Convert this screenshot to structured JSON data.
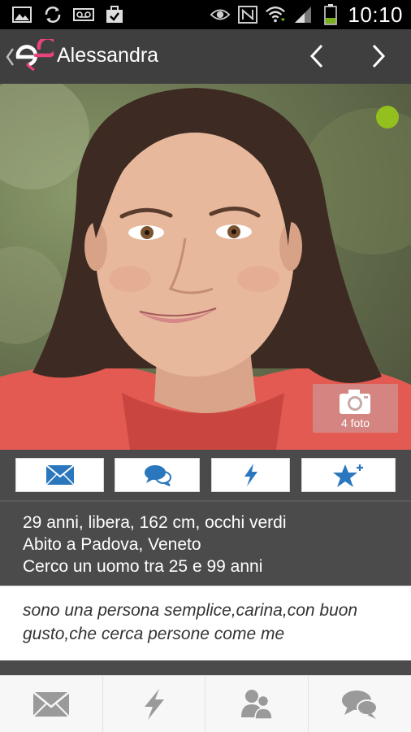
{
  "status_bar": {
    "time": "10:10",
    "icons": [
      "image-icon",
      "sync-icon",
      "voicemail-icon",
      "briefcase-icon",
      "eye-icon",
      "nfc-icon",
      "wifi-icon",
      "signal-icon",
      "battery-icon"
    ]
  },
  "header": {
    "title": "Alessandra",
    "logo": "app-logo",
    "nav_prev_icon": "chevron-left-icon",
    "nav_next_icon": "chevron-right-icon"
  },
  "photo": {
    "online": true,
    "online_color": "#93c01f",
    "photo_count_label": "4 foto"
  },
  "actions": [
    {
      "name": "message-button",
      "icon": "envelope-icon"
    },
    {
      "name": "chat-button",
      "icon": "chat-bubbles-icon"
    },
    {
      "name": "flash-button",
      "icon": "lightning-icon"
    },
    {
      "name": "favorite-button",
      "icon": "star-plus-icon"
    }
  ],
  "profile": {
    "details": "29 anni, libera, 162 cm, occhi verdi",
    "location": "Abito a Padova, Veneto",
    "seeking": "Cerco un uomo tra 25 e 99 anni",
    "bio": "sono una persona semplice,carina,con buon gusto,che cerca persone come me"
  },
  "bottom_nav": [
    {
      "name": "tab-messages",
      "icon": "envelope-icon"
    },
    {
      "name": "tab-flash",
      "icon": "lightning-icon"
    },
    {
      "name": "tab-contacts",
      "icon": "users-icon"
    },
    {
      "name": "tab-chat",
      "icon": "chat-bubbles-icon"
    }
  ],
  "colors": {
    "accent_blue": "#2a77bd",
    "header_bg": "#3f3f3f",
    "logo_pink": "#e8447a",
    "icon_gray": "#9a9a9a"
  }
}
